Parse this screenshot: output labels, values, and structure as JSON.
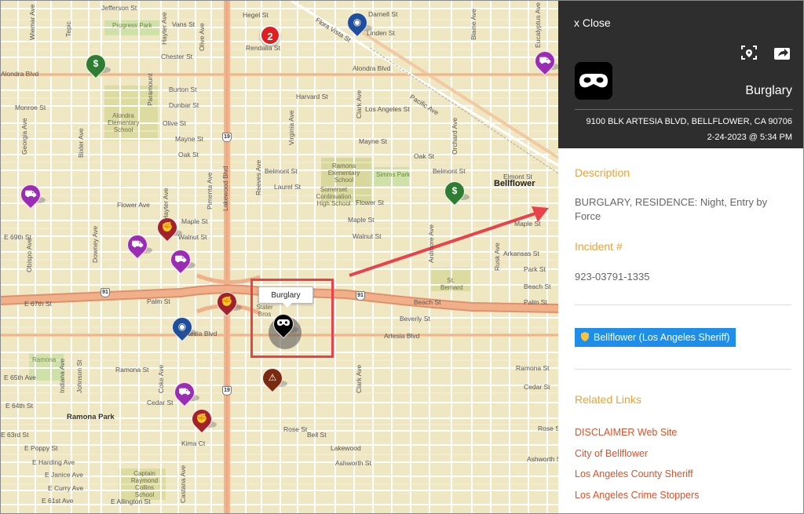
{
  "map": {
    "cluster_count": "2",
    "tooltip": "Burglary",
    "places": {
      "city": "Bellflower",
      "town": "Ramona Park"
    },
    "parks": [
      "Progress Park",
      "Simms Park",
      "Ramona"
    ],
    "schools": [
      "Alondra Elementary School",
      "Ramona Elementary School",
      "Somerset Continuation High School",
      "Captain Raymond Collins School",
      "St. Bernard",
      "Stater Bros"
    ],
    "highway_shields": [
      "19",
      "91",
      "91",
      "19"
    ],
    "streets_h": [
      "Jefferson St",
      "Vans St",
      "Hegel St",
      "Rendalia St",
      "Darnell St",
      "Linden St",
      "Chester St",
      "Alondra Blvd",
      "Burton St",
      "Dunbar St",
      "Harvard St",
      "Los Angeles St",
      "Monroe St",
      "Olive St",
      "Mayne St",
      "Oak St",
      "Belmont St",
      "Laurel St",
      "Flower Ave",
      "Maple St",
      "Walnut St",
      "E 69th St",
      "Palm St",
      "E 67th St",
      "Beach St",
      "Beverly St",
      "Artesia Blvd",
      "Ramona St",
      "Cedar St",
      "E 65th Ave",
      "E 64th St",
      "Rose St",
      "Kima Ct",
      "E Poppy St",
      "E Harding Ave",
      "E Janice Ave",
      "E Curry Ave",
      "E 61st Ave",
      "E Allington St",
      "E 63rd St",
      "Arkansas St",
      "Park St",
      "Ashworth St",
      "Lakewood",
      "Bell St",
      "Flower St",
      "Elmont St"
    ],
    "streets_v": [
      "Wiemar Ave",
      "Hayter Ave",
      "Olive Ave",
      "Pimenta Ave",
      "Lakewood Blvd",
      "Reeves Ave",
      "Virginia Ave",
      "Clark Ave",
      "Orchard Ave",
      "Bixler Ave",
      "Georgia Ave",
      "Downey Ave",
      "Obispo Ave",
      "Indiana Ave",
      "Johnson St",
      "Coke Ave",
      "Castana Ave",
      "Ardmore Ave",
      "Blaine Ave",
      "Rose Ave",
      "Eucalyptus Ave",
      "Rusk Ave",
      "Tepic",
      "Paramount"
    ],
    "streets_diag": [
      "Flora Vista St",
      "Pacific Ave"
    ],
    "markers": [
      {
        "type": "robbery",
        "color": "#2f7d32"
      },
      {
        "type": "robbery",
        "color": "#2f7d32"
      },
      {
        "type": "vehicle",
        "color": "#9b2db5"
      },
      {
        "type": "vehicle",
        "color": "#9b2db5"
      },
      {
        "type": "vehicle",
        "color": "#9b2db5"
      },
      {
        "type": "vehicle",
        "color": "#9b2db5"
      },
      {
        "type": "vehicle",
        "color": "#9b2db5"
      },
      {
        "type": "assault",
        "color": "#a3222a"
      },
      {
        "type": "assault",
        "color": "#a3222a"
      },
      {
        "type": "assault",
        "color": "#a3222a"
      },
      {
        "type": "police",
        "color": "#1e4e9c"
      },
      {
        "type": "police",
        "color": "#1e4e9c"
      },
      {
        "type": "vandalism",
        "color": "#7a2b0f"
      },
      {
        "type": "burglary",
        "color": "#000000"
      }
    ]
  },
  "panel": {
    "close_label": "x Close",
    "crime_type": "Burglary",
    "address": "9100 BLK ARTESIA BLVD, BELLFLOWER, CA 90706",
    "datetime": "2-24-2023 @ 5:34 PM",
    "description_title": "Description",
    "description": "BURGLARY, RESIDENCE: Night, Entry by Force",
    "incident_title": "Incident #",
    "incident_number": "923-03791-1335",
    "agency": "Bellflower (Los Angeles Sheriff)",
    "related_title": "Related Links",
    "links": [
      "DISCLAIMER Web Site",
      "City of Bellflower",
      "Los Angeles County Sheriff",
      "Los Angeles Crime Stoppers"
    ],
    "accent_color": "#f0a030",
    "link_color": "#e0502a",
    "badge_color": "#1f8ee8",
    "header_bg": "#2e2e2e",
    "icons": [
      "focus-icon",
      "share-icon",
      "burglar-mask-icon",
      "sheriff-badge-icon"
    ]
  }
}
